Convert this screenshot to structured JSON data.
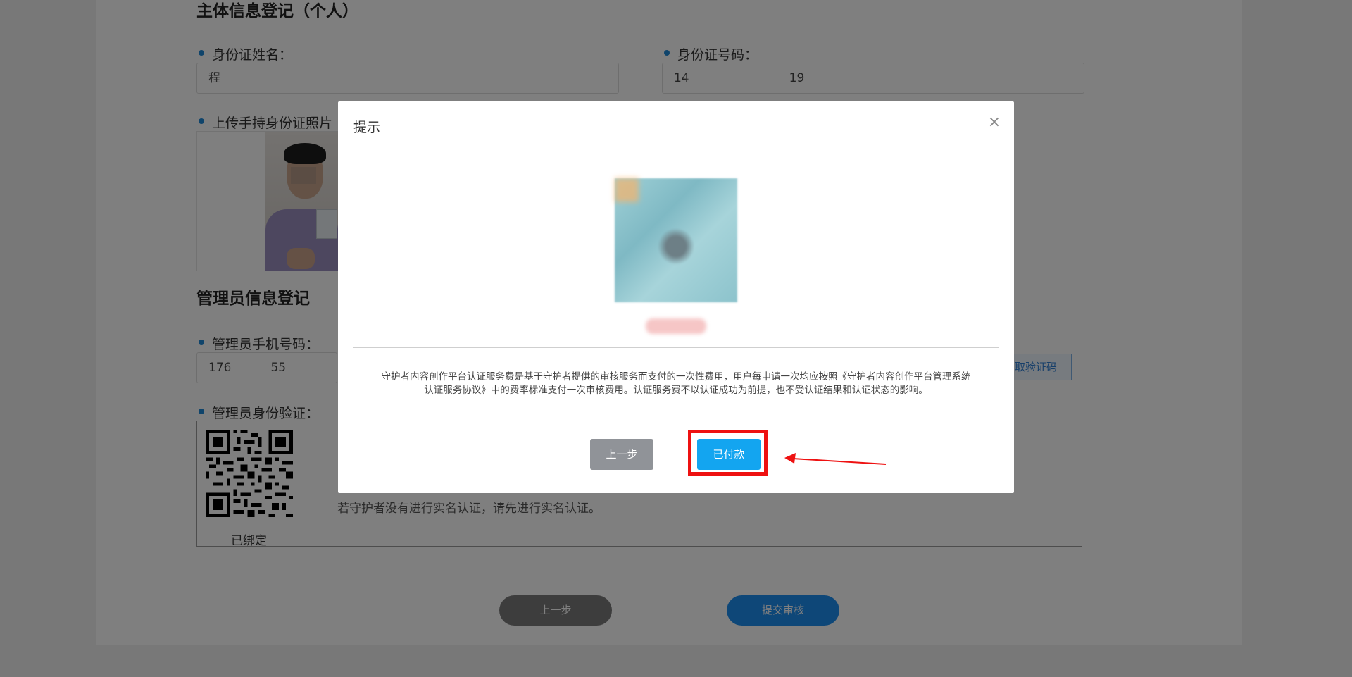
{
  "personal_section": {
    "title": "主体信息登记（个人）",
    "name_label": "身份证姓名：",
    "name_value": "程",
    "id_label": "身份证号码：",
    "id_value_prefix": "14",
    "id_value_suffix": "19",
    "photo_label": "上传手持身份证照片"
  },
  "admin_section": {
    "title": "管理员信息登记",
    "phone_label": "管理员手机号码：",
    "phone_prefix": "176",
    "phone_suffix": "55",
    "get_code_label": "取验证码",
    "verify_label": "管理员身份验证：",
    "bound_label": "已绑定",
    "verify_hint": "若守护者没有进行实名认证，请先进行实名认证。"
  },
  "bottom_buttons": {
    "prev_label": "上一步",
    "submit_label": "提交审核"
  },
  "modal": {
    "title": "提示",
    "close_icon": "close-icon",
    "notice": "守护者内容创作平台认证服务费是基于守护者提供的审核服务而支付的一次性费用，用户每申请一次均应按照《守护者内容创作平台管理系统认证服务协议》中的费率标准支付一次审核费用。认证服务费不以认证成功为前提，也不受认证结果和认证状态的影响。",
    "prev_label": "上一步",
    "paid_label": "已付款"
  },
  "colors": {
    "accent": "#13a5f0",
    "highlight": "#ee1111",
    "bullet": "#1e88d6"
  }
}
